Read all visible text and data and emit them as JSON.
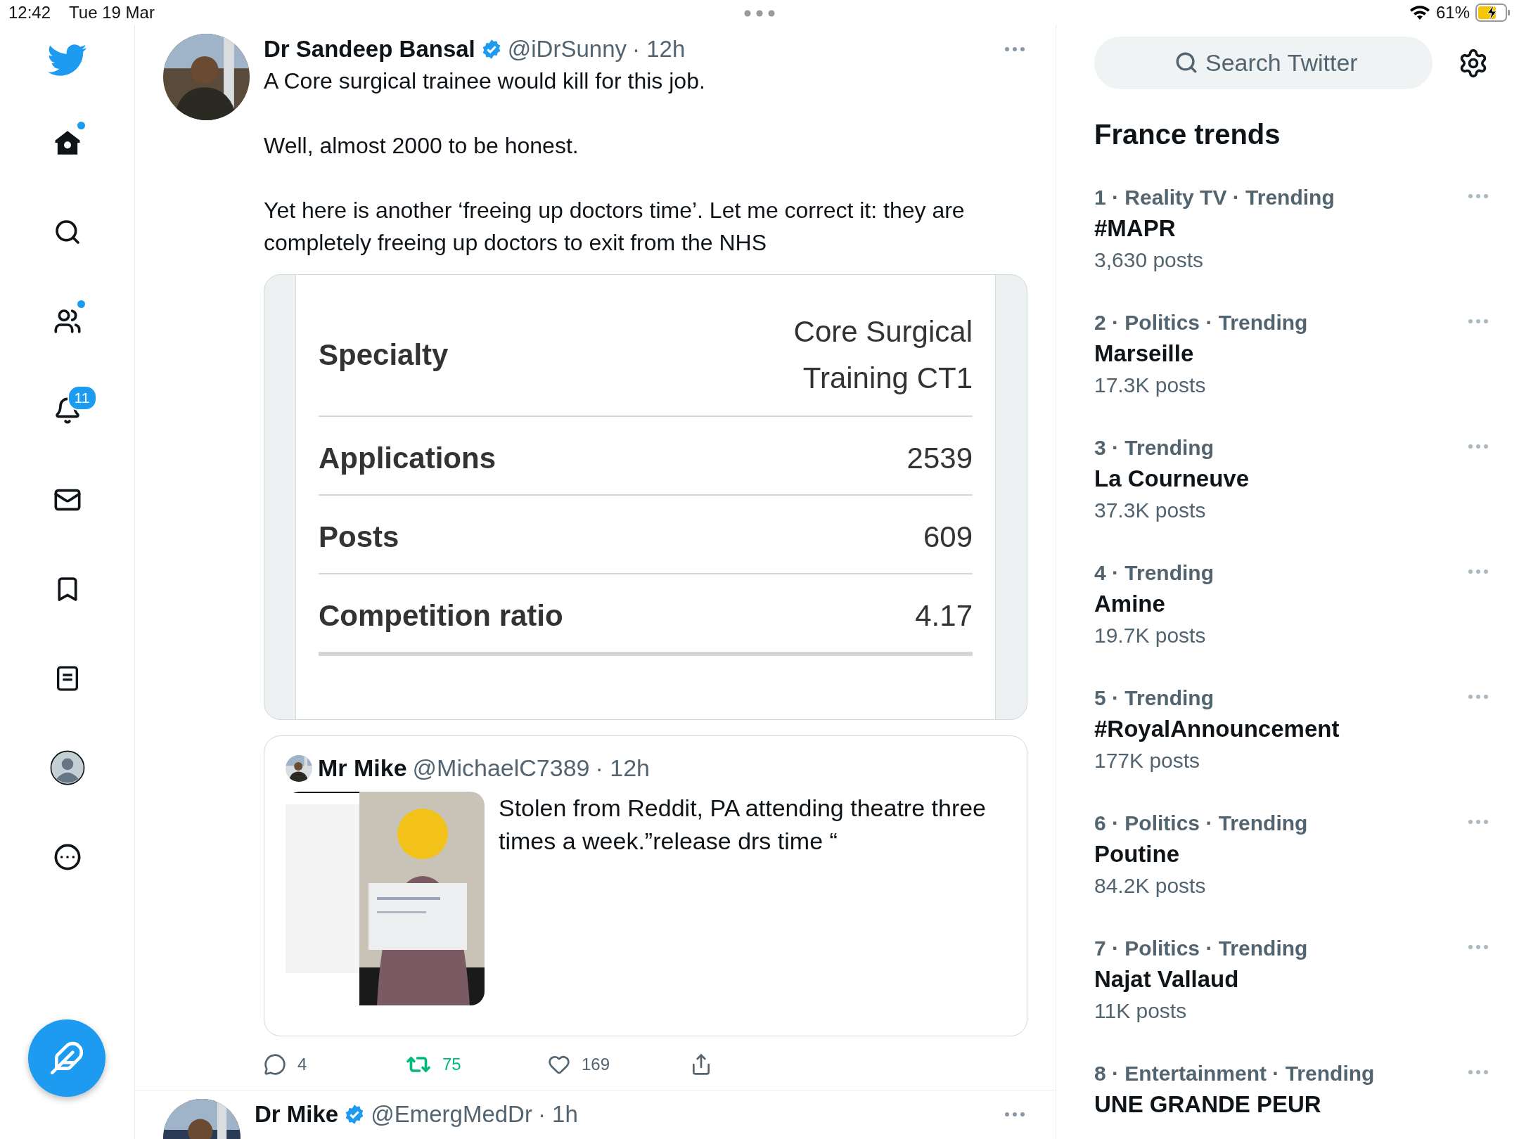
{
  "status_bar": {
    "time": "12:42",
    "date": "Tue 19 Mar",
    "battery": "61%"
  },
  "sidebar": {
    "items": [
      {
        "kind": "home",
        "dot": true
      },
      {
        "kind": "explore",
        "dot": false
      },
      {
        "kind": "communities",
        "dot": true
      },
      {
        "kind": "notifications",
        "dot": false,
        "badge": "11"
      },
      {
        "kind": "messages",
        "dot": false
      },
      {
        "kind": "bookmarks",
        "dot": false
      },
      {
        "kind": "lists",
        "dot": false
      },
      {
        "kind": "profile",
        "dot": false
      },
      {
        "kind": "more",
        "dot": false
      }
    ]
  },
  "tweets": [
    {
      "name": "Dr Sandeep Bansal",
      "verified": true,
      "handle": "@iDrSunny",
      "time": "· 12h",
      "paragraphs": [
        "A Core surgical trainee would kill for this job.",
        "Well, almost 2000 to be honest.",
        "Yet here is another ‘freeing up doctors time’. Let me correct it: they are completely freeing up doctors to exit from the NHS"
      ],
      "document": {
        "rows": [
          {
            "label": "Specialty",
            "value": "Core Surgical Training CT1"
          },
          {
            "label": "Applications",
            "value": "2539"
          },
          {
            "label": "Posts",
            "value": "609"
          },
          {
            "label": "Competition ratio",
            "value": "4.17"
          }
        ]
      },
      "quote": {
        "name": "Mr Mike",
        "handle": "@MichaelC7389",
        "time": "· 12h",
        "text": "Stolen from Reddit, PA attending theatre three times a week.”release drs time “"
      },
      "actions": {
        "replies": "4",
        "retweets": "75",
        "retweeted": true,
        "likes": "169",
        "liked": false
      }
    },
    {
      "name": "Dr Mike",
      "verified": true,
      "handle": "@EmergMedDr",
      "time": "· 1h"
    }
  ],
  "search": {
    "placeholder": "Search Twitter"
  },
  "trends": {
    "title": "France trends",
    "items": [
      {
        "context": "1 · Reality TV · Trending",
        "name": "#MAPR",
        "posts": "3,630 posts"
      },
      {
        "context": "2 · Politics · Trending",
        "name": "Marseille",
        "posts": "17.3K posts"
      },
      {
        "context": "3 · Trending",
        "name": "La Courneuve",
        "posts": "37.3K posts"
      },
      {
        "context": "4 · Trending",
        "name": "Amine",
        "posts": "19.7K posts"
      },
      {
        "context": "5 · Trending",
        "name": "#RoyalAnnouncement",
        "posts": "177K posts"
      },
      {
        "context": "6 · Politics · Trending",
        "name": "Poutine",
        "posts": "84.2K posts"
      },
      {
        "context": "7 · Politics · Trending",
        "name": "Najat Vallaud",
        "posts": "11K posts"
      },
      {
        "context": "8 · Entertainment · Trending",
        "name": "UNE GRANDE PEUR"
      }
    ]
  }
}
